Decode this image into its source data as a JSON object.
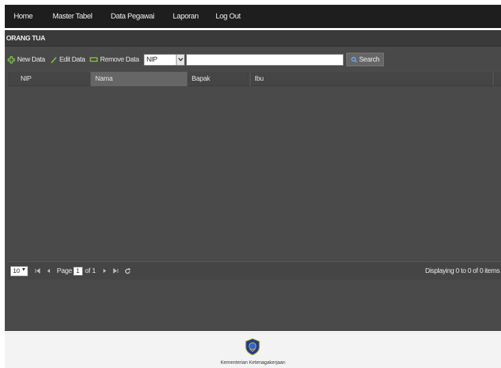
{
  "nav": {
    "items": [
      "Home",
      "Master Tabel",
      "Data Pegawai",
      "Laporan",
      "Log Out"
    ]
  },
  "panel": {
    "title": "ORANG TUA"
  },
  "toolbar": {
    "new_label": "New Data",
    "edit_label": "Edit Data",
    "remove_label": "Remove Data",
    "field_selected": "NIP",
    "search_value": "",
    "search_label": "Search"
  },
  "grid": {
    "columns": [
      "NIP",
      "Nama",
      "Bapak",
      "Ibu"
    ],
    "rows": []
  },
  "pager": {
    "page_size": "10",
    "page_label": "Page",
    "page_value": "1",
    "of_label": "of 1",
    "display_info": "Displaying 0 to 0 of 0 items"
  },
  "footer": {
    "org_name": "Kementerian Ketenagakerjaan"
  },
  "colors": {
    "navbar": "#1e1e1e",
    "panel": "#4a4a4a",
    "new_icon": "#7fd63a",
    "edit_icon": "#7fd63a",
    "remove_icon": "#7fd63a",
    "search_icon": "#6ab0ff"
  }
}
